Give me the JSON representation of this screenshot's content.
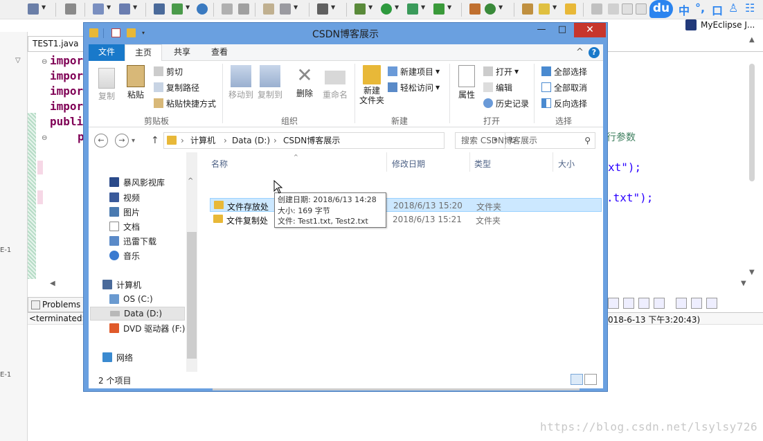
{
  "eclipse": {
    "editor_tab": "TEST1.java",
    "code_lines": [
      "impor",
      "impor",
      "impor",
      "impor",
      "publi",
      "p"
    ],
    "code_right": [
      "xt\");",
      ".txt\");"
    ],
    "comment_fragment": "行参数",
    "gutter_labels": [
      "E-1",
      "E-1"
    ],
    "problems_tab": "Problems",
    "console_left": "<terminated>",
    "console_right": "018-6-13 下午3:20:43)",
    "myeclipse_label": "MyEclipse J...",
    "ime": {
      "logo": "du",
      "items": [
        "中",
        "°,",
        "口",
        "♙",
        "☷"
      ]
    }
  },
  "explorer": {
    "title": "CSDN博客展示",
    "ribbon_tabs": [
      "文件",
      "主页",
      "共享",
      "查看"
    ],
    "help_label": "?",
    "groups": {
      "clipboard": {
        "label": "剪贴板",
        "copy": "复制",
        "paste": "粘贴",
        "cut": "剪切",
        "copy_path": "复制路径",
        "paste_shortcut": "粘贴快捷方式"
      },
      "organize": {
        "label": "组织",
        "move_to": "移动到",
        "copy_to": "复制到",
        "delete": "删除",
        "rename": "重命名"
      },
      "new": {
        "label": "新建",
        "new_folder": "新建\n文件夹",
        "new_item": "新建项目",
        "easy_access": "轻松访问"
      },
      "open": {
        "label": "打开",
        "properties": "属性",
        "open": "打开",
        "edit": "编辑",
        "history": "历史记录"
      },
      "select": {
        "label": "选择",
        "select_all": "全部选择",
        "select_none": "全部取消",
        "invert": "反向选择"
      }
    },
    "address": [
      "计算机",
      "Data (D:)",
      "CSDN博客展示"
    ],
    "search_placeholder": "搜索 CSDN博客展示",
    "nav_items": [
      "暴风影视库",
      "视频",
      "图片",
      "文档",
      "迅雷下载",
      "音乐",
      "计算机",
      "OS (C:)",
      "Data (D:)",
      "DVD 驱动器 (F:)",
      "网络"
    ],
    "columns": [
      "名称",
      "修改日期",
      "类型",
      "大小"
    ],
    "files": [
      {
        "name": "文件存放处",
        "date": "2018/6/13 15:20",
        "type": "文件夹"
      },
      {
        "name": "文件复制处",
        "date": "2018/6/13 15:21",
        "type": "文件夹"
      }
    ],
    "tooltip": {
      "created": "创建日期: 2018/6/13 14:28",
      "size": "大小: 169 字节",
      "files": "文件: Test1.txt, Test2.txt"
    },
    "status": "2 个项目"
  },
  "watermark": "https://blog.csdn.net/lsylsy726"
}
